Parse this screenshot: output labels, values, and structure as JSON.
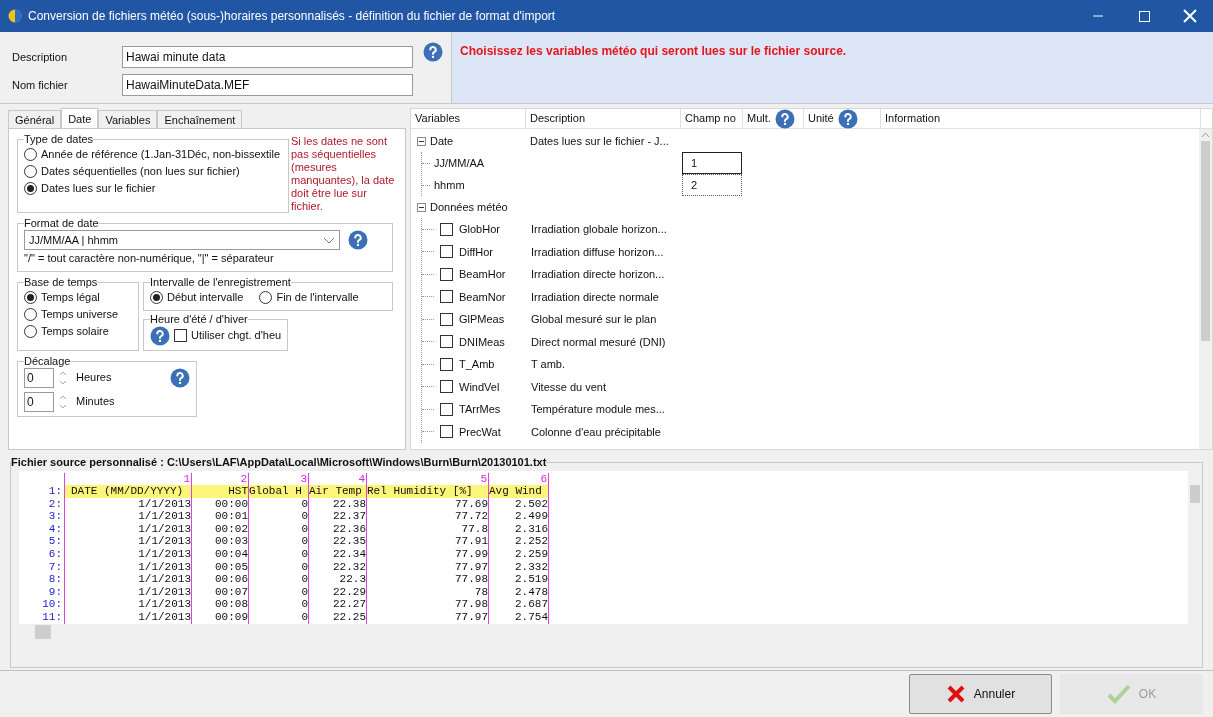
{
  "window": {
    "title": "Conversion de fichiers météo (sous-)horaires personnalisés - définition du fichier de format d'import"
  },
  "header": {
    "fields": [
      {
        "label": "Description",
        "value": "Hawai minute data"
      },
      {
        "label": "Nom fichier",
        "value": "HawaiMinuteData.MEF"
      }
    ],
    "message": "Choisissez les variables météo qui seront lues sur le fichier source."
  },
  "tabs": [
    {
      "label": "Général",
      "selected": false
    },
    {
      "label": "Date",
      "selected": true
    },
    {
      "label": "Variables",
      "selected": false
    },
    {
      "label": "Enchaînement",
      "selected": false
    }
  ],
  "date_tab": {
    "date_type": {
      "title": "Type de dates",
      "options": [
        {
          "label": "Année de référence (1.Jan-31Déc, non-bissextile",
          "selected": false
        },
        {
          "label": "Dates séquentielles (non lues sur fichier)",
          "selected": false
        },
        {
          "label": "Dates lues sur le fichier",
          "selected": true
        }
      ]
    },
    "note": "Si les dates ne sont pas séquentielles (mesures manquantes), la date doit être lue sur fichier.",
    "format": {
      "title": "Format de date",
      "value": "JJ/MM/AA | hhmm",
      "hint": "\"/\" = tout caractère non-numérique, \"|\" = séparateur"
    },
    "time_base": {
      "title": "Base de temps",
      "options": [
        {
          "label": "Temps légal",
          "selected": true
        },
        {
          "label": "Temps universe",
          "selected": false
        },
        {
          "label": "Temps solaire",
          "selected": false
        }
      ]
    },
    "interval": {
      "title": "Intervalle de l'enregistrement",
      "options": [
        {
          "label": "Début intervalle",
          "selected": true
        },
        {
          "label": "Fin de l'intervalle",
          "selected": false
        }
      ]
    },
    "dst": {
      "title": "Heure d'été / d'hiver",
      "checkbox": {
        "label": "Utiliser chgt. d'heu",
        "checked": false
      }
    },
    "offset": {
      "title": "Décalage",
      "spinners": [
        {
          "value": "0",
          "label": "Heures"
        },
        {
          "value": "0",
          "label": "Minutes"
        }
      ]
    }
  },
  "variables": {
    "columns": [
      {
        "label": "Variables",
        "help": false
      },
      {
        "label": "Description",
        "help": false
      },
      {
        "label": "Champ no",
        "help": false
      },
      {
        "label": "Mult.",
        "help": true
      },
      {
        "label": "Unité",
        "help": true
      },
      {
        "label": "Information",
        "help": false
      }
    ],
    "tree": [
      {
        "label": "Date",
        "description": "Dates lues sur le fichier - J...",
        "expanded": true,
        "children": [
          {
            "kind": "field",
            "label": "JJ/MM/AA",
            "field_no": "1",
            "focused": true
          },
          {
            "kind": "field",
            "label": "hhmm",
            "field_no": "2",
            "focused": false
          }
        ]
      },
      {
        "label": "Données météo",
        "expanded": true,
        "children": [
          {
            "kind": "check",
            "label": "GlobHor",
            "description": "Irradiation globale horizon...",
            "checked": false
          },
          {
            "kind": "check",
            "label": "DiffHor",
            "description": "Irradiation diffuse horizon...",
            "checked": false
          },
          {
            "kind": "check",
            "label": "BeamHor",
            "description": "Irradiation directe horizon...",
            "checked": false
          },
          {
            "kind": "check",
            "label": "BeamNor",
            "description": "Irradiation directe normale",
            "checked": false
          },
          {
            "kind": "check",
            "label": "GlPMeas",
            "description": "Global mesuré sur le plan",
            "checked": false
          },
          {
            "kind": "check",
            "label": "DNIMeas",
            "description": "Direct normal mesuré (DNI)",
            "checked": false
          },
          {
            "kind": "check",
            "label": "T_Amb",
            "description": "T amb.",
            "checked": false
          },
          {
            "kind": "check",
            "label": "WindVel",
            "description": "Vitesse du vent",
            "checked": false
          },
          {
            "kind": "check",
            "label": "TArrMes",
            "description": "Température module mes...",
            "checked": false
          },
          {
            "kind": "check",
            "label": "PrecWat",
            "description": "Colonne d'eau précipitable",
            "checked": false
          }
        ]
      }
    ]
  },
  "source_file": {
    "title": "Fichier source personnalisé : C:\\Users\\LAF\\AppData\\Local\\Microsoft\\Windows\\Burn\\Burn\\20130101.txt",
    "column_numbers": [
      "1",
      "2",
      "3",
      "4",
      "5",
      "6"
    ],
    "rows": [
      {
        "kind": "header",
        "line": "1:",
        "cells": [
          "DATE (MM/DD/YYYY)",
          "HST",
          "Global H",
          "Air Temp",
          "Rel Humidity [%]",
          "Avg Wind"
        ]
      },
      {
        "kind": "data",
        "line": "2:",
        "cells": [
          "1/1/2013",
          "00:00",
          "0",
          "22.38",
          "77.69",
          "2.502"
        ]
      },
      {
        "kind": "data",
        "line": "3:",
        "cells": [
          "1/1/2013",
          "00:01",
          "0",
          "22.37",
          "77.72",
          "2.499"
        ]
      },
      {
        "kind": "data",
        "line": "4:",
        "cells": [
          "1/1/2013",
          "00:02",
          "0",
          "22.36",
          "77.8",
          "2.316"
        ]
      },
      {
        "kind": "data",
        "line": "5:",
        "cells": [
          "1/1/2013",
          "00:03",
          "0",
          "22.35",
          "77.91",
          "2.252"
        ]
      },
      {
        "kind": "data",
        "line": "6:",
        "cells": [
          "1/1/2013",
          "00:04",
          "0",
          "22.34",
          "77.99",
          "2.259"
        ]
      },
      {
        "kind": "data",
        "line": "7:",
        "cells": [
          "1/1/2013",
          "00:05",
          "0",
          "22.32",
          "77.97",
          "2.332"
        ]
      },
      {
        "kind": "data",
        "line": "8:",
        "cells": [
          "1/1/2013",
          "00:06",
          "0",
          "22.3",
          "77.98",
          "2.519"
        ]
      },
      {
        "kind": "data",
        "line": "9:",
        "cells": [
          "1/1/2013",
          "00:07",
          "0",
          "22.29",
          "78",
          "2.478"
        ]
      },
      {
        "kind": "data",
        "line": "10:",
        "cells": [
          "1/1/2013",
          "00:08",
          "0",
          "22.27",
          "77.98",
          "2.687"
        ]
      },
      {
        "kind": "data",
        "line": "11:",
        "cells": [
          "1/1/2013",
          "00:09",
          "0",
          "22.25",
          "77.97",
          "2.754"
        ]
      }
    ]
  },
  "buttons": [
    {
      "kind": "cancel",
      "label": "Annuler",
      "disabled": false
    },
    {
      "kind": "ok",
      "label": "OK",
      "disabled": true
    }
  ]
}
